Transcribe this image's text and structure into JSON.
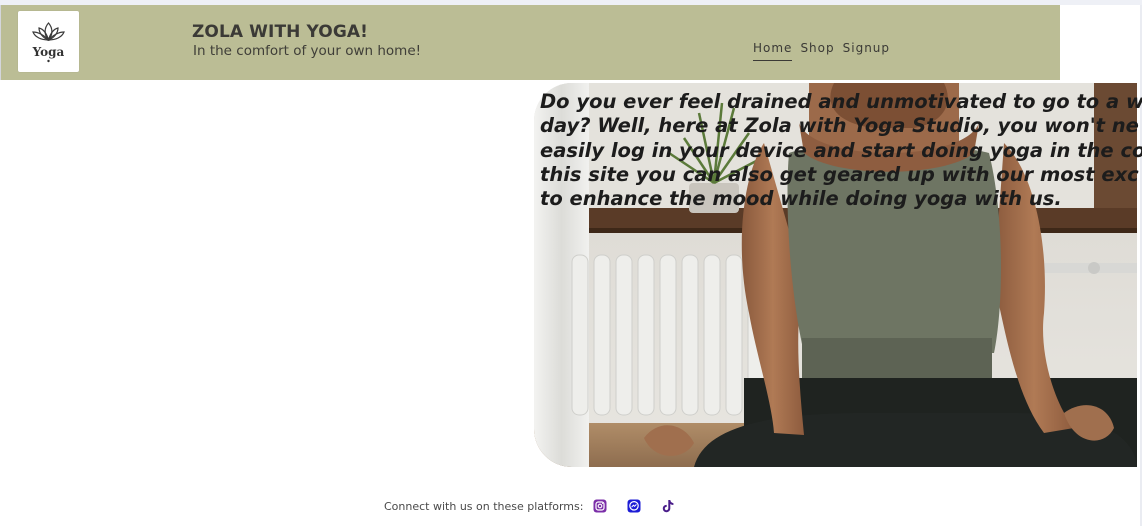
{
  "header": {
    "title": "ZOLA WITH YOGA!",
    "tagline": "In the comfort of your own home!",
    "logo_text": "Yoga"
  },
  "nav": {
    "items": [
      {
        "label": "Home",
        "active": true
      },
      {
        "label": "Shop",
        "active": false
      },
      {
        "label": "Signup",
        "active": false
      }
    ]
  },
  "hero": {
    "lines": [
      "Do you ever feel drained and unmotivated to go to a w",
      "day? Well, here at Zola with Yoga Studio, you won't ne",
      "easily log in your device and start doing yoga in the co",
      "this site you can also get geared up with our most exc",
      "to enhance the mood while doing yoga with us."
    ]
  },
  "footer": {
    "label": "Connect with us on these platforms:",
    "icons": [
      "instagram-icon",
      "messenger-icon",
      "tiktok-icon"
    ]
  },
  "colors": {
    "navbar": "#bbbd95",
    "text_dark": "#3b3a36",
    "instagram": "#7b2fa8",
    "messenger": "#1d1dd6",
    "tiktok": "#4a1d8a"
  }
}
